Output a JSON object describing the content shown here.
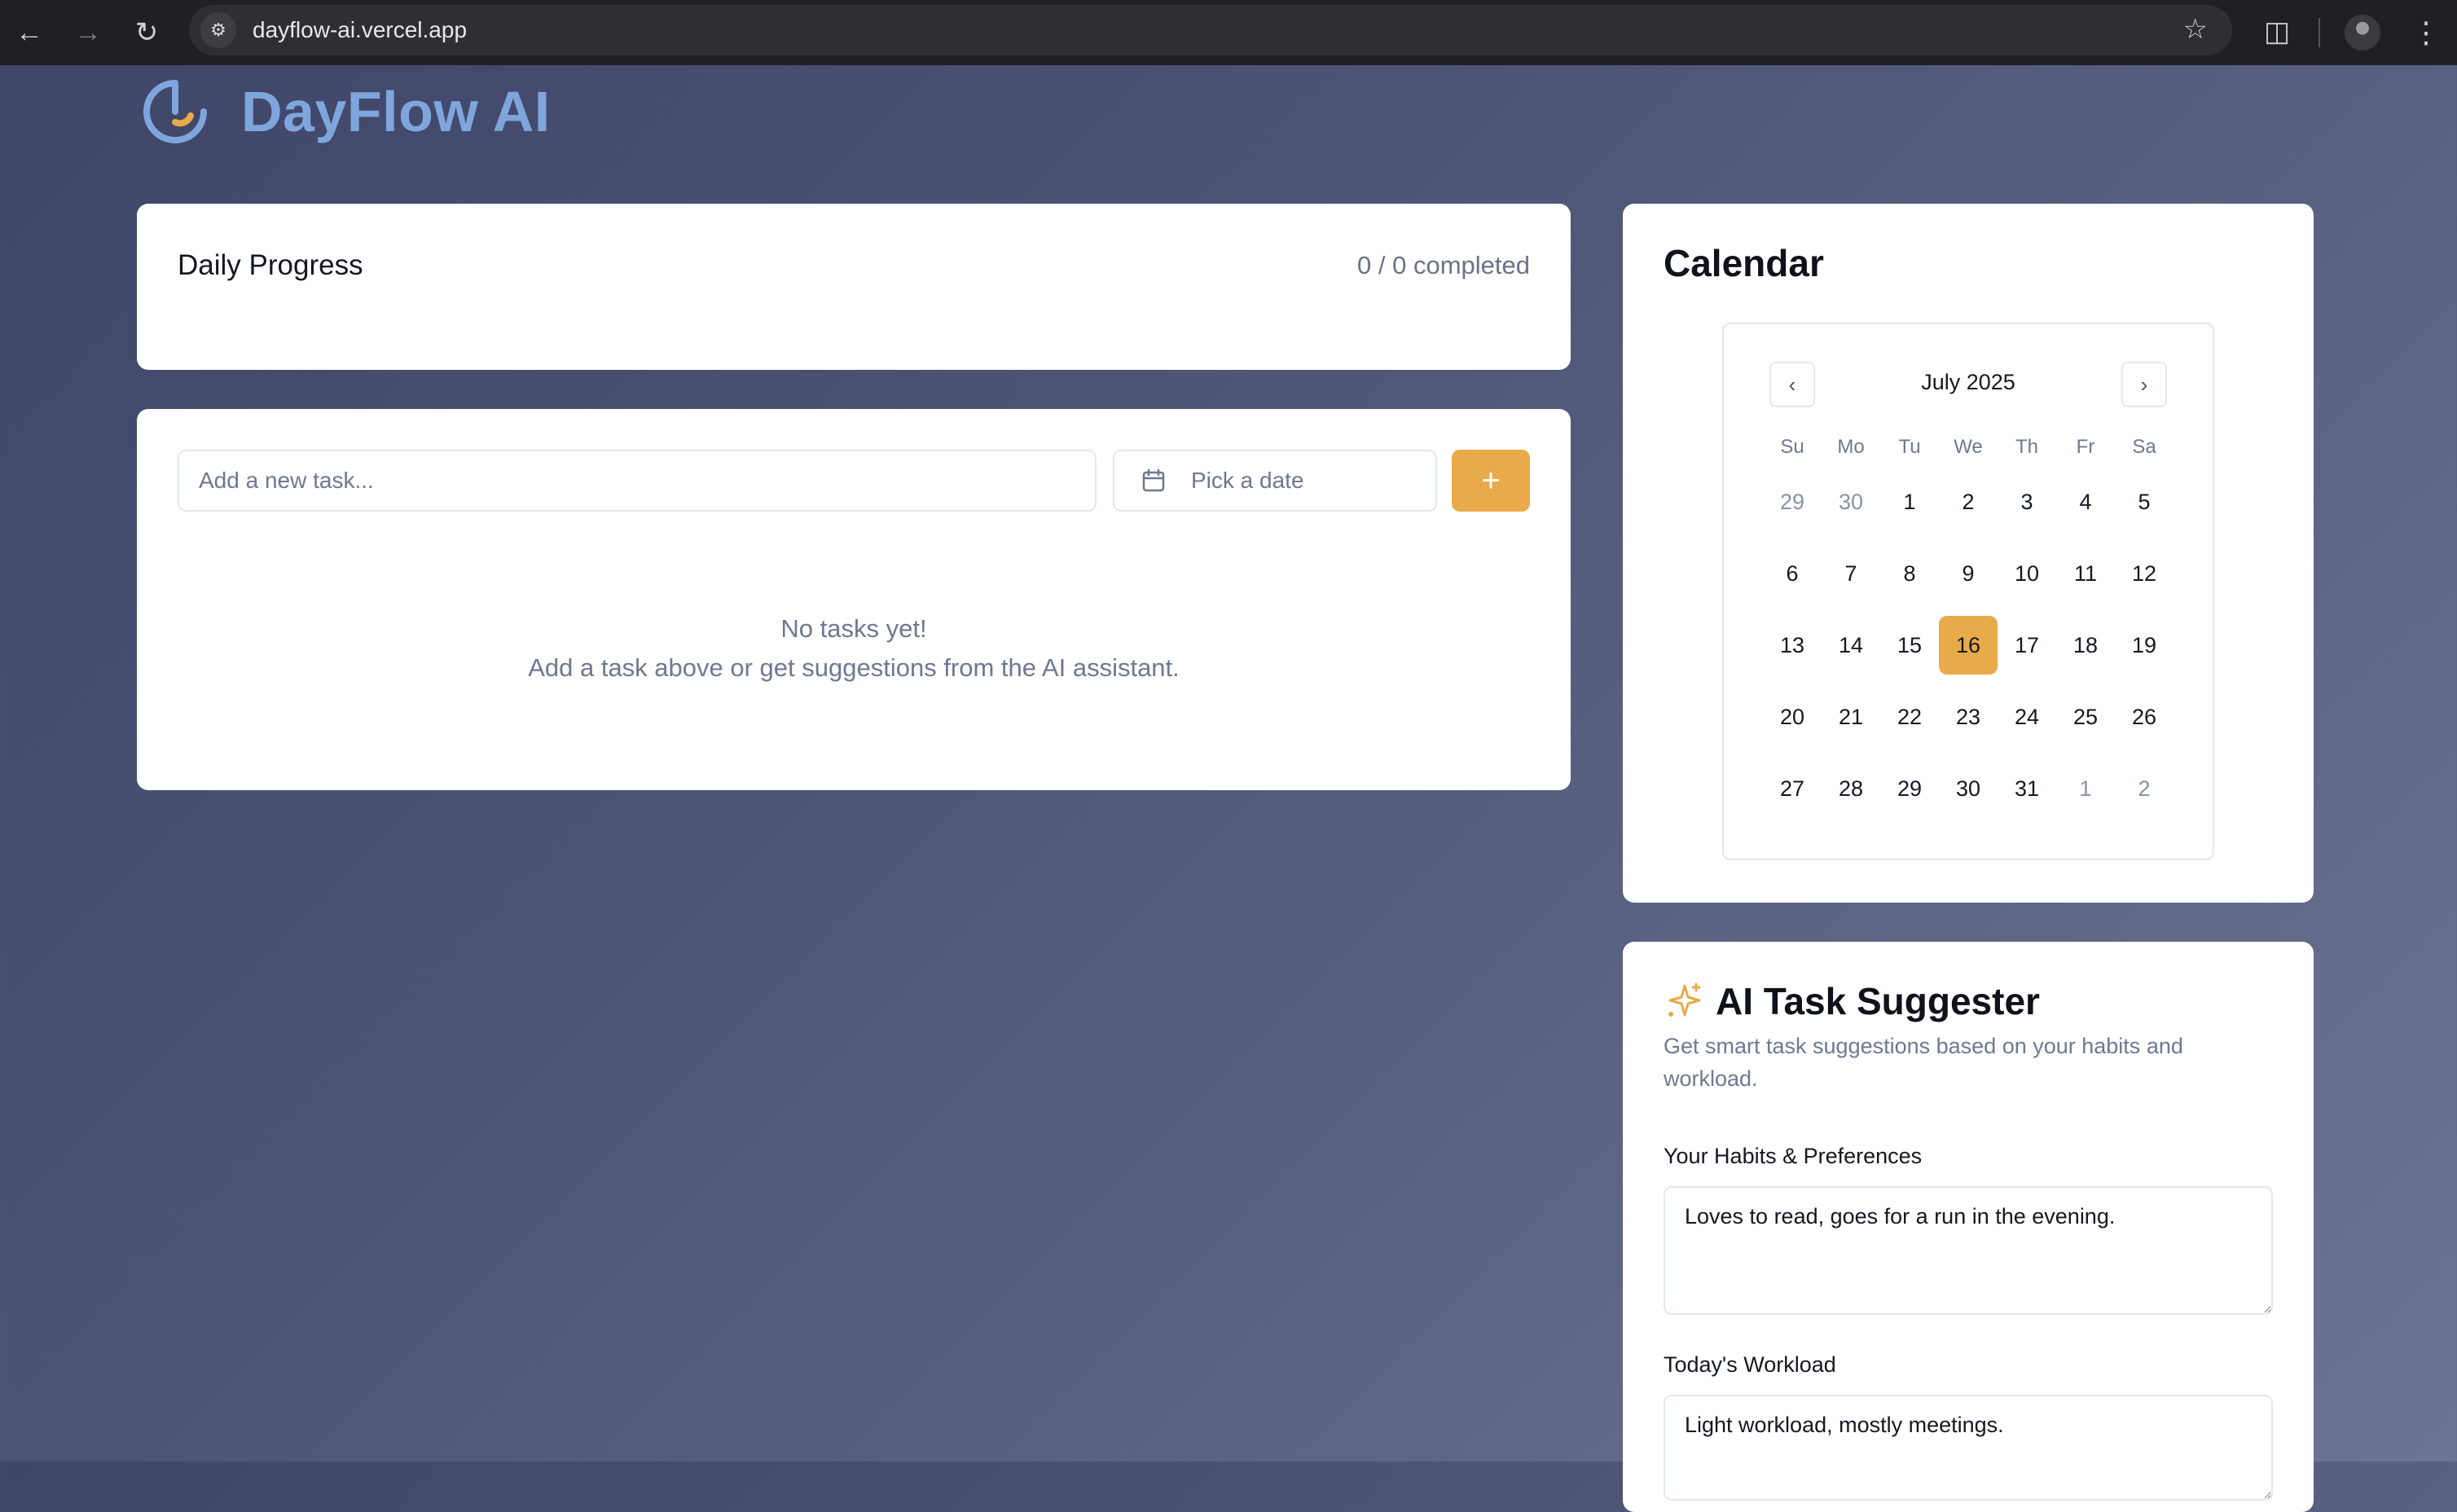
{
  "browser": {
    "url": "dayflow-ai.vercel.app",
    "icons": [
      "back-icon",
      "forward-icon",
      "reload-icon",
      "site-settings-icon",
      "bookmark-star-icon",
      "extensions-icon",
      "profile-avatar",
      "more-menu-icon"
    ]
  },
  "app": {
    "name": "DayFlow AI",
    "accent_color": "#e9aa4a",
    "logo_color": "#7ea6dc"
  },
  "progress": {
    "title": "Daily Progress",
    "status": "0 / 0 completed",
    "fraction": 0
  },
  "tasks": {
    "input_placeholder": "Add a new task...",
    "date_placeholder": "Pick a date",
    "add_icon": "plus-icon",
    "empty_title": "No tasks yet!",
    "empty_hint": "Add a task above or get suggestions from the AI assistant."
  },
  "calendar": {
    "title": "Calendar",
    "month_label": "July 2025",
    "weekdays": [
      "Su",
      "Mo",
      "Tu",
      "We",
      "Th",
      "Fr",
      "Sa"
    ],
    "days": [
      {
        "d": "29",
        "outside": true
      },
      {
        "d": "30",
        "outside": true
      },
      {
        "d": "1"
      },
      {
        "d": "2"
      },
      {
        "d": "3"
      },
      {
        "d": "4"
      },
      {
        "d": "5"
      },
      {
        "d": "6"
      },
      {
        "d": "7"
      },
      {
        "d": "8"
      },
      {
        "d": "9"
      },
      {
        "d": "10"
      },
      {
        "d": "11"
      },
      {
        "d": "12"
      },
      {
        "d": "13"
      },
      {
        "d": "14"
      },
      {
        "d": "15"
      },
      {
        "d": "16",
        "selected": true
      },
      {
        "d": "17"
      },
      {
        "d": "18"
      },
      {
        "d": "19"
      },
      {
        "d": "20"
      },
      {
        "d": "21"
      },
      {
        "d": "22"
      },
      {
        "d": "23"
      },
      {
        "d": "24"
      },
      {
        "d": "25"
      },
      {
        "d": "26"
      },
      {
        "d": "27"
      },
      {
        "d": "28"
      },
      {
        "d": "29"
      },
      {
        "d": "30"
      },
      {
        "d": "31"
      },
      {
        "d": "1",
        "outside": true
      },
      {
        "d": "2",
        "outside": true
      }
    ]
  },
  "ai": {
    "title": "AI Task Suggester",
    "description": "Get smart task suggestions based on your habits and workload.",
    "habits_label": "Your Habits & Preferences",
    "habits_value": "Loves to read, goes for a run in the evening.",
    "workload_label": "Today's Workload",
    "workload_value": "Light workload, mostly meetings."
  }
}
